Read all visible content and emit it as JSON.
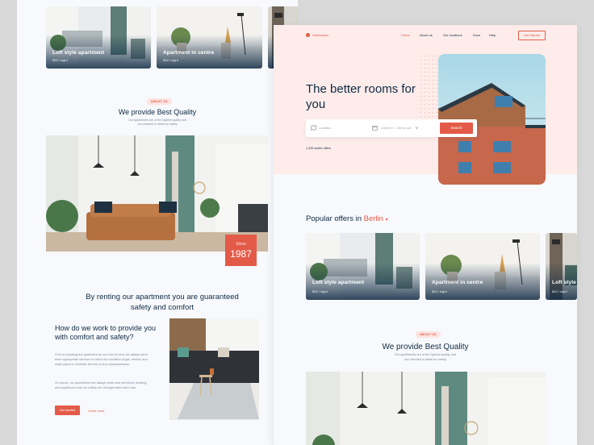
{
  "left": {
    "top_cards": [
      {
        "title": "Loft style apartment",
        "price": "$33 / night"
      },
      {
        "title": "Apartment in centre",
        "price": "$34 / night"
      }
    ],
    "about_badge": "ABOUT US",
    "quality_title": "We provide Best Quality",
    "quality_sub_1": "Our apartments are of the highest quality and",
    "quality_sub_2": "are checked in detail for safety",
    "since_label": "Since",
    "since_year": "1987",
    "renting_title": "By renting our apartment you are guaranteed safety and comfort",
    "how_title": "How do we work to provide you with comfort and safety?",
    "how_p1": "Prior to reporting the apartment by our host for rent, we always send there appropriate services to check the condition of gas, electric and water pipes to minimize the risk of any unpleasantness.",
    "how_p2": "Of course, our apartments are always clean and refreshed, bedding and appliances such as cutlery are changed after each user.",
    "get_started": "Get started",
    "learn_more": "Learn more"
  },
  "right": {
    "logo_text": "Hotelcaster",
    "nav": [
      "Home",
      "About us",
      "Our locations",
      "Docs",
      "Help"
    ],
    "get_started": "Get Started",
    "hero_title": "The better rooms for you",
    "search": {
      "location_placeholder": "Location",
      "dates_placeholder": "Check in - Check out",
      "button": "Search"
    },
    "offers_count": "1,333 active offers",
    "popular_prefix": "Popular offers in",
    "popular_city": "Berlin",
    "cards": [
      {
        "title": "Loft style apartment",
        "price": "$33 / night"
      },
      {
        "title": "Apartment in centre",
        "price": "$34 / night"
      },
      {
        "title": "Loft style",
        "price": "$43 / night"
      }
    ],
    "about_badge": "ABOUT US",
    "quality_title": "We provide Best Quality",
    "quality_sub_1": "Our apartments are of the highest quality and",
    "quality_sub_2": "are checked in detail for safety"
  },
  "colors": {
    "accent": "#e35b48",
    "navy": "#0f2a44",
    "hero_bg": "#fdecea"
  }
}
